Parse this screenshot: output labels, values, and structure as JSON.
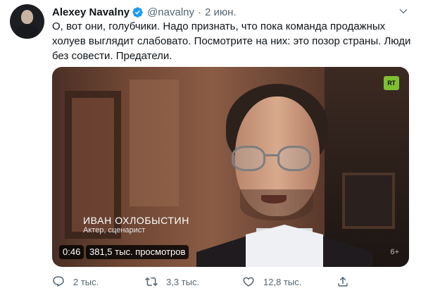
{
  "tweet": {
    "author_name": "Alexey Navalny",
    "handle": "@navalny",
    "separator": "·",
    "date": "2 июн.",
    "text": "О, вот они, голубчики. Надо признать, что пока команда продажных холуев выглядит слабовато. Посмотрите на них: это позор страны. Люди без совести. Предатели."
  },
  "video": {
    "channel_logo": "RT",
    "caption_name": "ИВАН ОХЛОБЫСТИН",
    "caption_role": "Актер, сценарист",
    "age_rating": "6+",
    "duration": "0:46",
    "views": "381,5 тыс. просмотров"
  },
  "actions": {
    "replies": "2 тыс.",
    "retweets": "3,3 тыс.",
    "likes": "12,8 тыс."
  },
  "icons": {
    "verified": "verified-badge-icon",
    "menu": "chevron-down-icon",
    "reply": "reply-icon",
    "retweet": "retweet-icon",
    "like": "heart-icon",
    "share": "share-icon"
  },
  "colors": {
    "accent": "#1d9bf0",
    "secondary_text": "#536471",
    "rt_green": "#7ec034"
  }
}
